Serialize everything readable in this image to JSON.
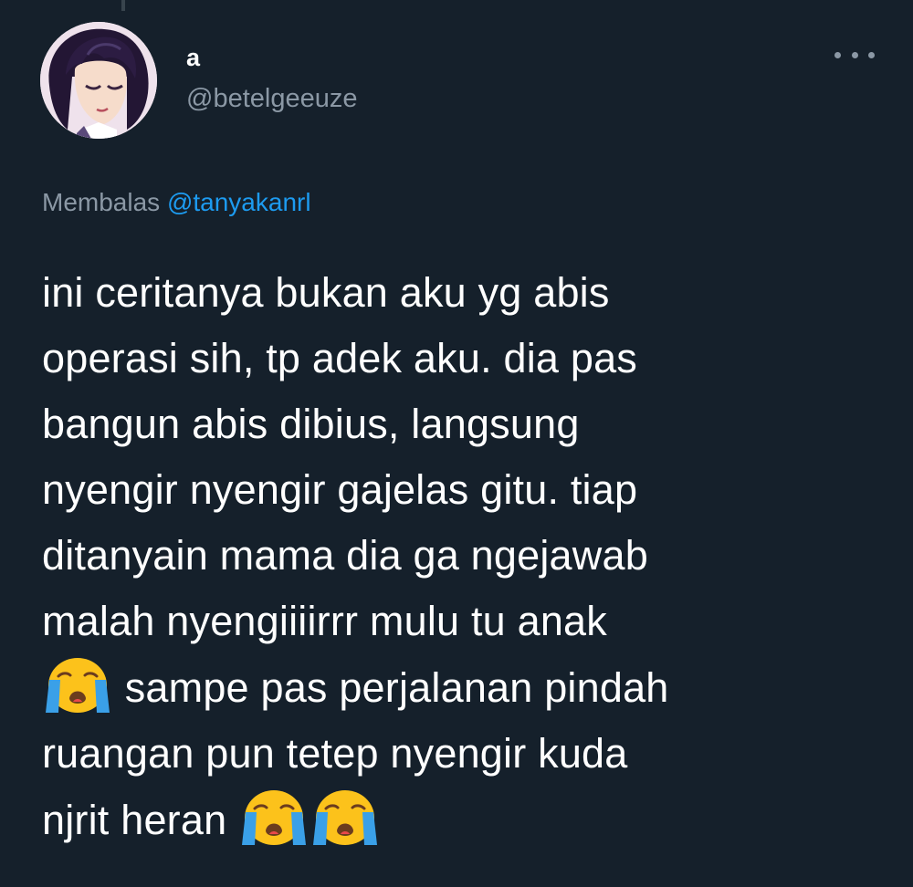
{
  "author": {
    "display_name": "a",
    "handle": "@betelgeeuze"
  },
  "reply": {
    "prefix": "Membalas",
    "mention": "@tanyakanrl"
  },
  "tweet": {
    "lines": [
      "ini ceritanya bukan aku yg abis",
      "operasi sih, tp adek aku. dia pas",
      "bangun abis dibius, langsung",
      "nyengir nyengir gajelas gitu. tiap",
      "ditanyain mama dia ga ngejawab",
      "malah nyengiiiirrr mulu tu anak",
      "sampe pas perjalanan pindah",
      "ruangan pun tetep nyengir kuda",
      "njrit heran"
    ],
    "emoji": "loudly-crying-face"
  },
  "icons": {
    "more": "more-horizontal-icon"
  },
  "colors": {
    "background": "#15202b",
    "text": "#ffffff",
    "secondary": "#8b98a5",
    "accent": "#1d9bf0"
  }
}
